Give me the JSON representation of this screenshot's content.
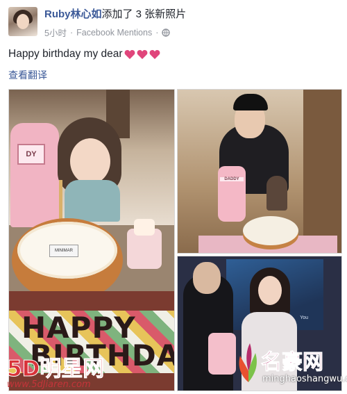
{
  "post": {
    "author": "Ruby林心如",
    "action": "添加了 3 张新照片",
    "time": "5小时",
    "separator": "·",
    "source": "Facebook Mentions",
    "separator2": "·",
    "text": "Happy birthday my dear",
    "translate_label": "查看翻译",
    "icons": [
      "globe-icon",
      "heart-icon",
      "heart-icon",
      "heart-icon"
    ],
    "heart_color": "#e0457b",
    "link_color": "#3b5998"
  },
  "photos": {
    "main": {
      "banner_line1": "HAPPY",
      "banner_line2": "BIRTHDAY",
      "toy_label": "DY",
      "cake_tag": "MINIMAR"
    },
    "top_right": {
      "toy_label": "DADDY"
    },
    "bottom_right": {
      "screen_text": "You"
    }
  },
  "watermarks": {
    "left_main": "5D明星网",
    "left_url": "www.5dJiaren.com",
    "right_main": "名豪网",
    "right_url": "minghaoshangwu.com",
    "left_color": "#d8333a",
    "right_color": "#b62d6b"
  }
}
